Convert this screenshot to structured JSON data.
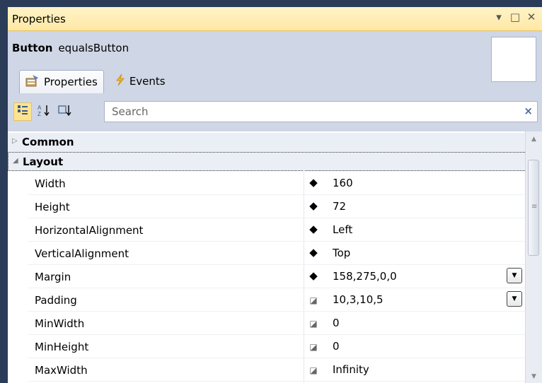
{
  "window": {
    "title": "Properties",
    "controls": {
      "dropdown": "▾",
      "maximize": "□",
      "close": "✕"
    }
  },
  "header": {
    "object_type": "Button",
    "object_name": "equalsButton"
  },
  "tabs": [
    {
      "label": "Properties",
      "icon": "properties-icon",
      "active": true
    },
    {
      "label": "Events",
      "icon": "lightning-icon",
      "active": false
    }
  ],
  "toolbar": {
    "categorized_icon": "categorized-icon",
    "alphabetical_icon": "sort-az-icon",
    "filter_icon": "sort-by-source-icon"
  },
  "search": {
    "placeholder": "Search",
    "clear": "×"
  },
  "categories": [
    {
      "label": "Common",
      "expanded": false
    },
    {
      "label": "Layout",
      "expanded": true
    }
  ],
  "properties": [
    {
      "name": "Width",
      "marker": "◆",
      "value": "160",
      "dropdown": false
    },
    {
      "name": "Height",
      "marker": "◆",
      "value": "72",
      "dropdown": false
    },
    {
      "name": "HorizontalAlignment",
      "marker": "◆",
      "value": "Left",
      "dropdown": false
    },
    {
      "name": "VerticalAlignment",
      "marker": "◆",
      "value": "Top",
      "dropdown": false
    },
    {
      "name": "Margin",
      "marker": "◆",
      "value": "158,275,0,0",
      "dropdown": true
    },
    {
      "name": "Padding",
      "marker": "◪",
      "value": "10,3,10,5",
      "dropdown": true
    },
    {
      "name": "MinWidth",
      "marker": "◪",
      "value": "0",
      "dropdown": false
    },
    {
      "name": "MinHeight",
      "marker": "◪",
      "value": "0",
      "dropdown": false
    },
    {
      "name": "MaxWidth",
      "marker": "◪",
      "value": "Infinity",
      "dropdown": false
    }
  ],
  "colors": {
    "titlebar": "#ffe8a6",
    "panel": "#cfd6e5",
    "frame": "#2b3c59",
    "toolbar_active": "#ffe48f"
  }
}
